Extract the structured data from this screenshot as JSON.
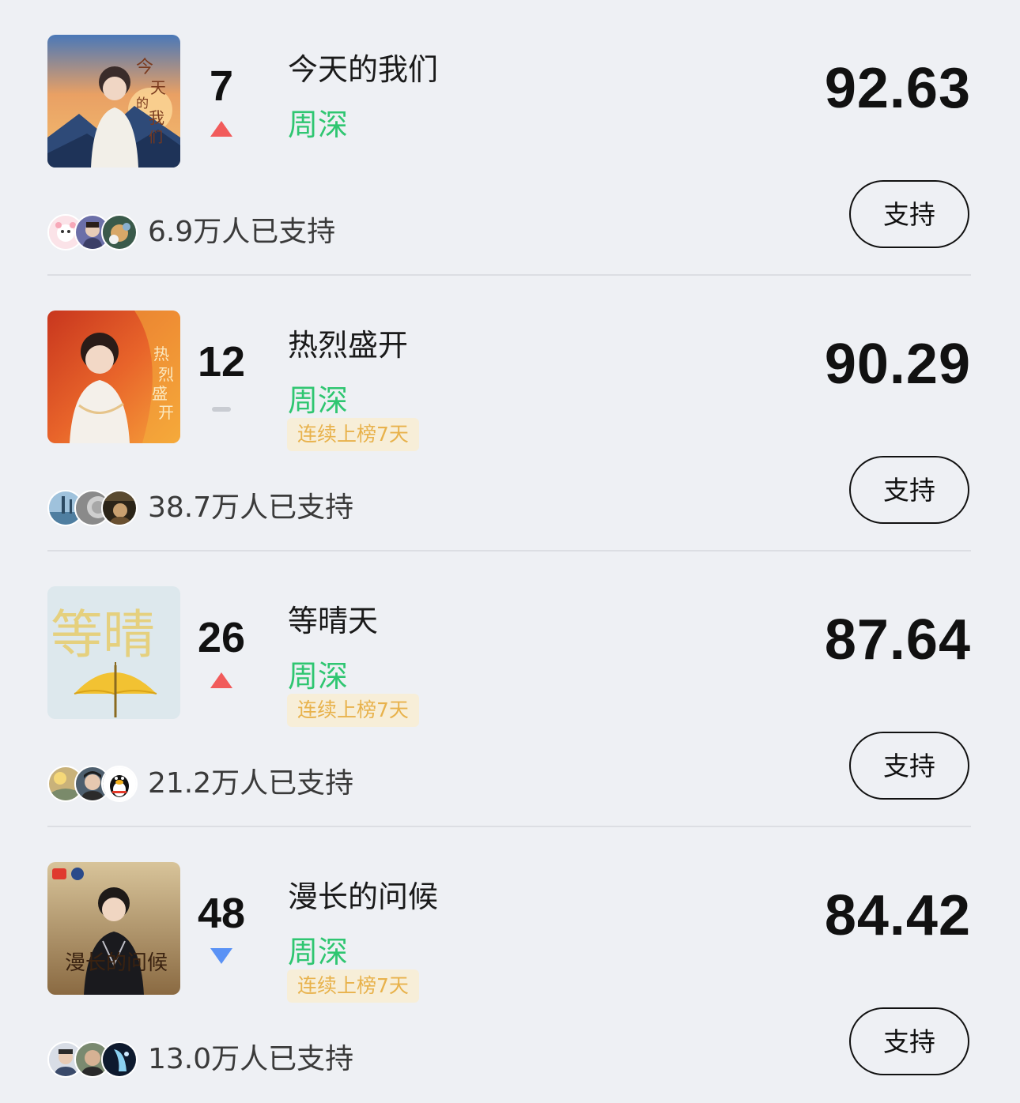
{
  "support_button_label": "支持",
  "colors": {
    "artist": "#2fc671",
    "rank_up": "#f15b5b",
    "rank_down": "#5a92f5",
    "rank_flat": "#c9ccd2",
    "streak_text": "#e8b24c",
    "streak_bg": "#f7eed8"
  },
  "items": [
    {
      "rank": "7",
      "trend": "up",
      "title": "今天的我们",
      "artist": "周深",
      "streak": "",
      "score": "92.63",
      "supporters": "6.9万人已支持",
      "cover_icon": "album-cover-sunset-mountains"
    },
    {
      "rank": "12",
      "trend": "flat",
      "title": "热烈盛开",
      "artist": "周深",
      "streak": "连续上榜7天",
      "score": "90.29",
      "supporters": "38.7万人已支持",
      "cover_icon": "album-cover-red-orange"
    },
    {
      "rank": "26",
      "trend": "up",
      "title": "等晴天",
      "artist": "周深",
      "streak": "连续上榜7天",
      "score": "87.64",
      "supporters": "21.2万人已支持",
      "cover_icon": "album-cover-yellow-umbrella"
    },
    {
      "rank": "48",
      "trend": "down",
      "title": "漫长的问候",
      "artist": "周深",
      "streak": "连续上榜7天",
      "score": "84.42",
      "supporters": "13.0万人已支持",
      "cover_icon": "album-cover-brown-paper"
    }
  ]
}
